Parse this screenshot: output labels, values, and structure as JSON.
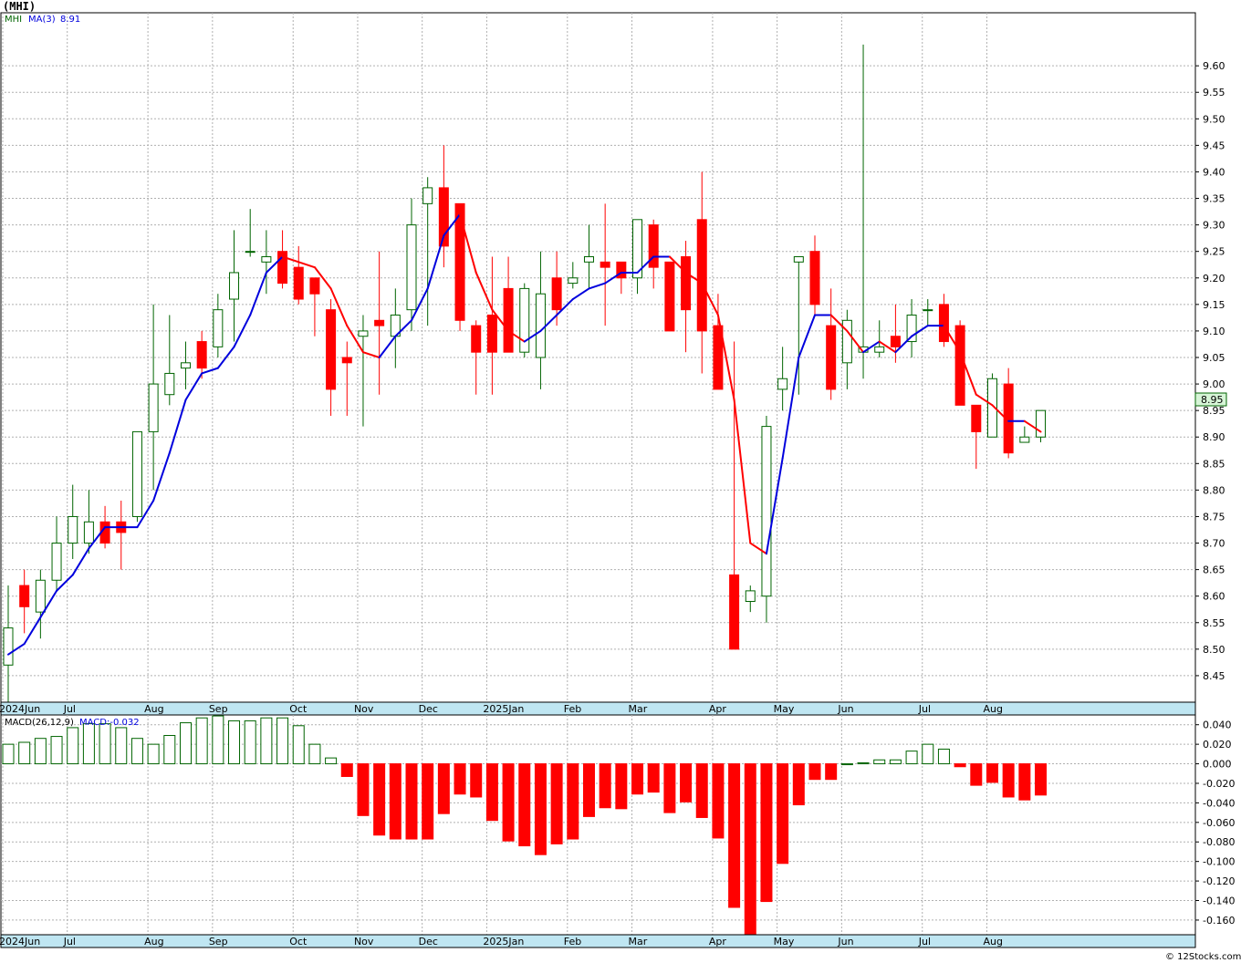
{
  "title": "(MHI)",
  "credit": "© 12Stocks.com",
  "price_legend": {
    "symbol": "MHI",
    "ma_label": "MA(3)",
    "ma_value": "8.91"
  },
  "macd_legend": {
    "label": "MACD(26,12,9)",
    "value_label": "MACD:-0.032"
  },
  "last_price_tag": "8.95",
  "colors": {
    "up": "#006400",
    "down": "#ff0000",
    "ma_rising": "#0000dd",
    "ma_falling": "#ff0000",
    "axis_band": "#bfe6f2",
    "grid": "#b0b0b0"
  },
  "chart_data": [
    {
      "type": "candlestick",
      "title": "(MHI)",
      "ylim": [
        8.4,
        9.7
      ],
      "y_ticks": [
        "8.45",
        "8.50",
        "8.55",
        "8.60",
        "8.65",
        "8.70",
        "8.75",
        "8.80",
        "8.85",
        "8.90",
        "8.95",
        "9.00",
        "9.05",
        "9.10",
        "9.15",
        "9.20",
        "9.25",
        "9.30",
        "9.35",
        "9.40",
        "9.45",
        "9.50",
        "9.55",
        "9.60"
      ],
      "x_labels": [
        "2024Jun",
        "Jul",
        "Aug",
        "Sep",
        "Oct",
        "Nov",
        "Dec",
        "2025Jan",
        "Feb",
        "Mar",
        "Apr",
        "May",
        "Jun",
        "Jul",
        "Aug"
      ],
      "x_label_weeks": [
        0,
        4,
        9,
        13,
        18,
        22,
        26,
        30,
        35,
        39,
        44,
        48,
        52,
        57,
        61
      ],
      "grid": true,
      "ohlc": [
        [
          8.47,
          8.62,
          8.4,
          8.54
        ],
        [
          8.62,
          8.65,
          8.53,
          8.58
        ],
        [
          8.57,
          8.65,
          8.52,
          8.63
        ],
        [
          8.63,
          8.75,
          8.61,
          8.7
        ],
        [
          8.7,
          8.81,
          8.67,
          8.75
        ],
        [
          8.7,
          8.8,
          8.68,
          8.74
        ],
        [
          8.74,
          8.77,
          8.69,
          8.7
        ],
        [
          8.74,
          8.78,
          8.65,
          8.72
        ],
        [
          8.75,
          8.91,
          8.74,
          8.91
        ],
        [
          8.91,
          9.15,
          8.8,
          9.0
        ],
        [
          8.98,
          9.13,
          8.96,
          9.02
        ],
        [
          9.03,
          9.08,
          8.99,
          9.04
        ],
        [
          9.08,
          9.1,
          9.01,
          9.03
        ],
        [
          9.07,
          9.17,
          9.05,
          9.14
        ],
        [
          9.16,
          9.29,
          9.08,
          9.21
        ],
        [
          9.25,
          9.33,
          9.24,
          9.25
        ],
        [
          9.23,
          9.29,
          9.17,
          9.24
        ],
        [
          9.25,
          9.29,
          9.18,
          9.19
        ],
        [
          9.22,
          9.26,
          9.15,
          9.16
        ],
        [
          9.2,
          9.2,
          9.09,
          9.17
        ],
        [
          9.14,
          9.16,
          8.94,
          8.99
        ],
        [
          9.05,
          9.08,
          8.94,
          9.04
        ],
        [
          9.09,
          9.13,
          8.92,
          9.1
        ],
        [
          9.12,
          9.25,
          8.98,
          9.11
        ],
        [
          9.09,
          9.18,
          9.03,
          9.13
        ],
        [
          9.14,
          9.35,
          9.1,
          9.3
        ],
        [
          9.34,
          9.39,
          9.11,
          9.37
        ],
        [
          9.37,
          9.45,
          9.22,
          9.26
        ],
        [
          9.34,
          9.34,
          9.1,
          9.12
        ],
        [
          9.11,
          9.12,
          8.98,
          9.06
        ],
        [
          9.13,
          9.24,
          8.98,
          9.06
        ],
        [
          9.18,
          9.24,
          9.07,
          9.06
        ],
        [
          9.06,
          9.19,
          9.05,
          9.18
        ],
        [
          9.05,
          9.25,
          8.99,
          9.17
        ],
        [
          9.2,
          9.25,
          9.11,
          9.14
        ],
        [
          9.19,
          9.23,
          9.18,
          9.2
        ],
        [
          9.23,
          9.3,
          9.18,
          9.24
        ],
        [
          9.23,
          9.34,
          9.11,
          9.22
        ],
        [
          9.23,
          9.23,
          9.17,
          9.2
        ],
        [
          9.2,
          9.31,
          9.17,
          9.31
        ],
        [
          9.3,
          9.31,
          9.18,
          9.22
        ],
        [
          9.23,
          9.23,
          9.1,
          9.1
        ],
        [
          9.24,
          9.27,
          9.06,
          9.14
        ],
        [
          9.31,
          9.4,
          9.02,
          9.1
        ],
        [
          9.11,
          9.17,
          8.99,
          8.99
        ],
        [
          8.64,
          9.08,
          8.5,
          8.5
        ],
        [
          8.59,
          8.62,
          8.57,
          8.61
        ],
        [
          8.6,
          8.94,
          8.55,
          8.92
        ],
        [
          8.99,
          9.07,
          8.95,
          9.01
        ],
        [
          9.23,
          9.24,
          8.98,
          9.24
        ],
        [
          9.25,
          9.28,
          9.13,
          9.15
        ],
        [
          9.11,
          9.18,
          8.97,
          8.99
        ],
        [
          9.04,
          9.14,
          8.99,
          9.12
        ],
        [
          9.06,
          9.64,
          9.01,
          9.07
        ],
        [
          9.06,
          9.12,
          9.05,
          9.07
        ],
        [
          9.09,
          9.15,
          9.04,
          9.07
        ],
        [
          9.08,
          9.16,
          9.05,
          9.13
        ],
        [
          9.14,
          9.16,
          9.11,
          9.14
        ],
        [
          9.15,
          9.17,
          9.07,
          9.08
        ],
        [
          9.11,
          9.12,
          8.96,
          8.96
        ],
        [
          8.96,
          8.96,
          8.84,
          8.91
        ],
        [
          8.9,
          9.02,
          8.9,
          9.01
        ],
        [
          9.0,
          9.03,
          8.86,
          8.87
        ],
        [
          8.89,
          8.92,
          8.89,
          8.9
        ],
        [
          8.9,
          8.95,
          8.89,
          8.95
        ]
      ],
      "ma3": [
        8.49,
        8.51,
        8.56,
        8.61,
        8.64,
        8.69,
        8.73,
        8.73,
        8.73,
        8.78,
        8.87,
        8.97,
        9.02,
        9.03,
        9.07,
        9.13,
        9.21,
        9.24,
        9.23,
        9.22,
        9.18,
        9.11,
        9.06,
        9.05,
        9.09,
        9.12,
        9.18,
        9.28,
        9.32,
        9.21,
        9.14,
        9.1,
        9.08,
        9.1,
        9.13,
        9.16,
        9.18,
        9.19,
        9.21,
        9.21,
        9.24,
        9.24,
        9.21,
        9.19,
        9.13,
        8.97,
        8.7,
        8.68,
        8.86,
        9.05,
        9.13,
        9.13,
        9.1,
        9.06,
        9.08,
        9.06,
        9.09,
        9.11,
        9.11,
        9.06,
        8.98,
        8.96,
        8.93,
        8.93,
        8.91
      ],
      "ma3_start_week": 0
    },
    {
      "type": "bar",
      "title": "MACD(26,12,9)",
      "ylim": [
        -0.175,
        0.05
      ],
      "y_ticks": [
        "0.040",
        "0.020",
        "0.000",
        "-0.020",
        "-0.040",
        "-0.060",
        "-0.080",
        "-0.100",
        "-0.120",
        "-0.140",
        "-0.160"
      ],
      "x_labels": [
        "2024Jun",
        "Jul",
        "Aug",
        "Sep",
        "Oct",
        "Nov",
        "Dec",
        "2025Jan",
        "Feb",
        "Mar",
        "Apr",
        "May",
        "Jun",
        "Jul",
        "Aug"
      ],
      "values": [
        0.02,
        0.022,
        0.026,
        0.028,
        0.037,
        0.041,
        0.041,
        0.037,
        0.026,
        0.02,
        0.029,
        0.042,
        0.047,
        0.049,
        0.044,
        0.044,
        0.047,
        0.047,
        0.039,
        0.02,
        0.006,
        -0.013,
        -0.053,
        -0.073,
        -0.077,
        -0.077,
        -0.077,
        -0.051,
        -0.031,
        -0.034,
        -0.058,
        -0.079,
        -0.084,
        -0.093,
        -0.082,
        -0.077,
        -0.054,
        -0.045,
        -0.046,
        -0.031,
        -0.029,
        -0.05,
        -0.039,
        -0.055,
        -0.076,
        -0.147,
        -0.178,
        -0.141,
        -0.102,
        -0.042,
        -0.016,
        -0.016,
        0.0,
        0.001,
        0.004,
        0.004,
        0.013,
        0.02,
        0.015,
        -0.003,
        -0.022,
        -0.019,
        -0.034,
        -0.037,
        -0.032
      ],
      "grid": true
    }
  ]
}
